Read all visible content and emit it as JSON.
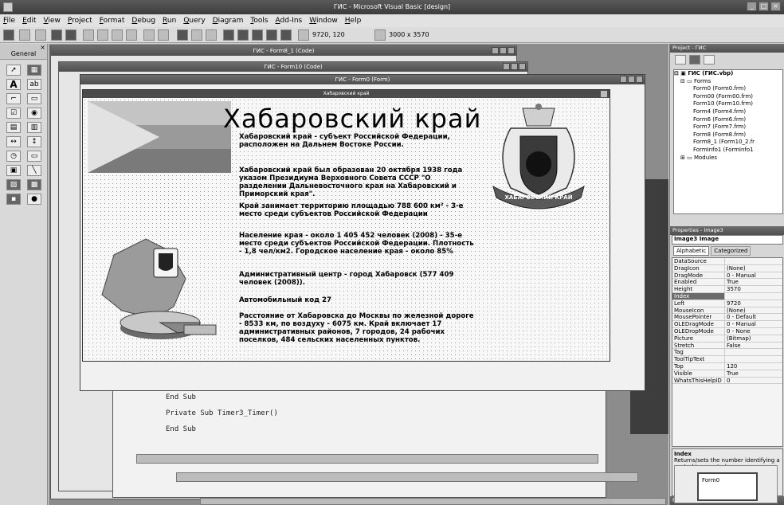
{
  "window": {
    "title": "ГИС - Microsoft Visual Basic [design]"
  },
  "menu": [
    "File",
    "Edit",
    "View",
    "Project",
    "Format",
    "Debug",
    "Run",
    "Query",
    "Diagram",
    "Tools",
    "Add-Ins",
    "Window",
    "Help"
  ],
  "toolbar": {
    "position": "9720, 120",
    "size": "3000 x 3570"
  },
  "toolbox": {
    "title": "General",
    "close": "×"
  },
  "windows": {
    "form8_code": "ГИС - Form8_1 (Code)",
    "form10_code": "ГИС - Form10 (Code)",
    "form0_form": "ГИС - Form0 (Form)",
    "form_caption": "Хабаровский край"
  },
  "code_lines": [
    "End Sub",
    "Private Sub Timer3_Timer()",
    "End Sub"
  ],
  "content": {
    "heading": "Хабаровский край",
    "para1": "Хабаровский край - субъект Российской Федерации, расположен на Дальнем Востоке России.",
    "para2": "Хабаровский край был образован 20 октября 1938 года указом Президиума Верховного Совета СССР \"О разделении Дальневосточного края на Хабаровский и Приморский края\".",
    "para3": "Край занимает территорию площадью 788 600 км² - 3-е место среди субъектов Российской Федерации",
    "para4": "Население края - около 1 405 452 человек (2008) - 35-е место среди субъектов Российской Федерации. Плотность - 1,8 чел/км2. Городское население края - около 85%",
    "para5": "Административный центр - город Хабаровск (577 409 человек (2008)).",
    "para6": "Автомобильный код 27",
    "para7": "Расстояние от Хабаровска до Москвы по железной дороге - 8533 км, по воздуху - 6075 км. Край включает 17 административных районов, 7 городов, 24 рабочих поселков, 484 сельских населенных пунктов.",
    "emblem_banner": "ХАБАРОВСКИЙ КРАЙ"
  },
  "project": {
    "title": "Project - ГИС",
    "root": "ГИС (ГИС.vbp)",
    "forms_label": "Forms",
    "forms": [
      "Form0 (Form0.frm)",
      "Form00 (Form00.frm)",
      "Form10 (Form10.frm)",
      "Form4 (Form4.frm)",
      "Form6 (Form6.frm)",
      "Form7 (Form7.frm)",
      "Form8 (Form8.frm)",
      "Form8_1 (Form10_2.fr",
      "FormInfo1 (FormInfo1"
    ],
    "modules_label": "Modules"
  },
  "properties": {
    "title": "Properties - Image3",
    "object": "Image3 Image",
    "tabs": [
      "Alphabetic",
      "Categorized"
    ],
    "rows": [
      [
        "DataSource",
        ""
      ],
      [
        "DragIcon",
        "(None)"
      ],
      [
        "DragMode",
        "0 - Manual"
      ],
      [
        "Enabled",
        "True"
      ],
      [
        "Height",
        "3570"
      ],
      [
        "Index",
        ""
      ],
      [
        "Left",
        "9720"
      ],
      [
        "MouseIcon",
        "(None)"
      ],
      [
        "MousePointer",
        "0 - Default"
      ],
      [
        "OLEDragMode",
        "0 - Manual"
      ],
      [
        "OLEDropMode",
        "0 - None"
      ],
      [
        "Picture",
        "(Bitmap)"
      ],
      [
        "Stretch",
        "False"
      ],
      [
        "Tag",
        ""
      ],
      [
        "ToolTipText",
        ""
      ],
      [
        "Top",
        "120"
      ],
      [
        "Visible",
        "True"
      ],
      [
        "WhatsThisHelpID",
        "0"
      ]
    ],
    "desc_title": "Index",
    "desc_text": "Returns/sets the number identifying a control in a control array."
  },
  "layout_panel": {
    "title": "Form Layout",
    "form_label": "Form0"
  }
}
